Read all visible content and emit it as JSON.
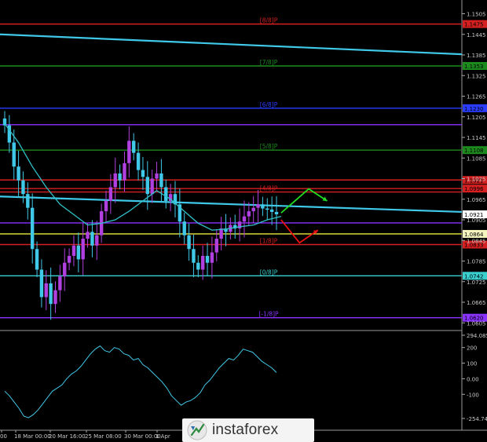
{
  "chart_data": [
    {
      "type": "candlestick",
      "ylim": [
        1.0585,
        1.1545
      ],
      "ytick_labels": [
        "1.1505",
        "1.1445",
        "1.1385",
        "1.1325",
        "1.1265",
        "1.1205",
        "1.1145",
        "1.1085",
        "1.1025",
        "1.0965",
        "1.0905",
        "1.0845",
        "1.0785",
        "1.0725",
        "1.0665",
        "1.0605"
      ],
      "xtick_labels": [
        "00",
        "18 Mar 00:00",
        "20 Mar 16:00",
        "25 Mar 08:00",
        "30 Mar 00:00",
        "1 Apr"
      ],
      "price_marker": {
        "value": 1.0921,
        "label": "1.0921"
      },
      "murrey_levels": [
        {
          "label": "[8/8]P",
          "value": 1.1475,
          "price_label": "1.1475",
          "color": "#d42020"
        },
        {
          "label": "[7/8]P",
          "value": 1.1353,
          "price_label": "1.1353",
          "color": "#1c8a1c"
        },
        {
          "label": "[6/8]P",
          "value": 1.123,
          "price_label": "1.1230",
          "color": "#2a3cff"
        },
        {
          "label": "",
          "value": 1.1182,
          "price_label": "",
          "color": "#8a32ff"
        },
        {
          "label": "[5/8]P",
          "value": 1.1108,
          "price_label": "1.1108",
          "color": "#1c8a1c"
        },
        {
          "label": "",
          "value": 1.1021,
          "price_label": "1.1021",
          "color": "#d42020"
        },
        {
          "label": "",
          "value": 1.0996,
          "price_label": "1.0996",
          "color": "#d42020"
        },
        {
          "label": "[4/8]P",
          "value": 1.0986,
          "price_label": "",
          "color": "#d42020"
        },
        {
          "label": "",
          "value": 1.0896,
          "price_label": "",
          "color": "#8a32ff"
        },
        {
          "label": "",
          "value": 1.0864,
          "price_label": "1.0864",
          "color": "#e8e840"
        },
        {
          "label": "[1/8]P",
          "value": 1.0833,
          "price_label": "1.0833",
          "color": "#d42020"
        },
        {
          "label": "[0/8]P",
          "value": 1.0742,
          "price_label": "1.0742",
          "color": "#3ad0d0"
        },
        {
          "label": "[-1/8]P",
          "value": 1.062,
          "price_label": "1.0620",
          "color": "#8a32ff"
        }
      ],
      "price_label_colors": {
        "1.0864": "#f5f5c0",
        "1.0742": "#3ad0d0"
      },
      "trend_lines": [
        {
          "from": [
            0,
            1.1445
          ],
          "to": [
            100,
            1.1387
          ]
        },
        {
          "from": [
            0,
            1.0973
          ],
          "to": [
            100,
            1.0928
          ]
        }
      ],
      "moving_average": [
        [
          0,
          1.1185
        ],
        [
          3,
          1.113
        ],
        [
          6,
          1.106
        ],
        [
          9,
          1.1
        ],
        [
          12,
          1.095
        ],
        [
          15,
          1.092
        ],
        [
          18,
          1.089
        ],
        [
          21,
          1.0895
        ],
        [
          24,
          1.0905
        ],
        [
          27,
          1.093
        ],
        [
          30,
          1.096
        ],
        [
          33,
          1.099
        ],
        [
          36,
          1.0965
        ],
        [
          39,
          1.093
        ],
        [
          42,
          1.0895
        ],
        [
          45,
          1.0875
        ],
        [
          48,
          1.0878
        ],
        [
          51,
          1.0885
        ],
        [
          54,
          1.089
        ],
        [
          57,
          1.0905
        ],
        [
          60,
          1.0915
        ]
      ],
      "candles_source": [
        [
          0,
          1.118
        ],
        [
          1,
          1.113
        ],
        [
          2,
          1.106
        ],
        [
          3,
          1.102
        ],
        [
          4,
          1.098
        ],
        [
          5,
          1.094
        ],
        [
          6,
          1.082
        ],
        [
          7,
          1.076
        ],
        [
          8,
          1.068
        ],
        [
          9,
          1.072
        ],
        [
          10,
          1.066
        ],
        [
          11,
          1.07
        ],
        [
          12,
          1.074
        ],
        [
          13,
          1.078
        ],
        [
          14,
          1.08
        ],
        [
          15,
          1.083
        ],
        [
          16,
          1.079
        ],
        [
          17,
          1.085
        ],
        [
          18,
          1.087
        ],
        [
          19,
          1.083
        ],
        [
          20,
          1.086
        ],
        [
          21,
          1.093
        ],
        [
          22,
          1.096
        ],
        [
          23,
          1.1
        ],
        [
          24,
          1.104
        ],
        [
          25,
          1.102
        ],
        [
          26,
          1.107
        ],
        [
          27,
          1.1135
        ],
        [
          28,
          1.11
        ],
        [
          29,
          1.105
        ],
        [
          30,
          1.103
        ],
        [
          31,
          1.098
        ],
        [
          32,
          1.1025
        ],
        [
          33,
          1.104
        ],
        [
          34,
          1.1
        ],
        [
          35,
          1.096
        ],
        [
          36,
          1.098
        ],
        [
          37,
          1.095
        ],
        [
          38,
          1.09
        ],
        [
          39,
          1.086
        ],
        [
          40,
          1.082
        ],
        [
          41,
          1.078
        ],
        [
          42,
          1.076
        ],
        [
          43,
          1.08
        ],
        [
          44,
          1.078
        ],
        [
          45,
          1.081
        ],
        [
          46,
          1.085
        ],
        [
          47,
          1.088
        ],
        [
          48,
          1.087
        ],
        [
          49,
          1.089
        ],
        [
          50,
          1.088
        ],
        [
          51,
          1.09
        ],
        [
          52,
          1.0915
        ],
        [
          53,
          1.093
        ],
        [
          54,
          1.094
        ],
        [
          55,
          1.095
        ],
        [
          56,
          1.0938
        ],
        [
          57,
          1.0935
        ],
        [
          58,
          1.0928
        ],
        [
          59,
          1.0921
        ]
      ],
      "forecast_arrows": [
        {
          "color": "#22dd22",
          "from": [
            60,
            1.0925
          ],
          "to": [
            66,
            1.0995
          ],
          "end": [
            70,
            1.096
          ]
        },
        {
          "color": "#ee1111",
          "from": [
            60,
            1.0905
          ],
          "to": [
            64,
            1.0838
          ],
          "end": [
            68,
            1.0875
          ]
        }
      ]
    },
    {
      "type": "line",
      "title": "",
      "ylim": [
        -290,
        294.0852
      ],
      "ytick_labels": [
        "294.0852",
        "200",
        "100",
        "0.00",
        "-100",
        "-254.746"
      ],
      "series": [
        {
          "values": [
            -80,
            -110,
            -150,
            -190,
            -240,
            -250,
            -230,
            -200,
            -160,
            -120,
            -80,
            -60,
            -40,
            0,
            30,
            50,
            80,
            120,
            160,
            190,
            210,
            180,
            170,
            200,
            190,
            160,
            150,
            120,
            130,
            90,
            70,
            40,
            10,
            -20,
            -60,
            -110,
            -140,
            -170,
            -150,
            -140,
            -120,
            -90,
            -40,
            -10,
            30,
            70,
            100,
            130,
            120,
            150,
            190,
            180,
            170,
            140,
            110,
            90,
            70,
            40
          ]
        }
      ],
      "color": "#40c8e8"
    }
  ],
  "watermark": {
    "text": "instaforex",
    "icon": "instaforex-logo-icon"
  }
}
